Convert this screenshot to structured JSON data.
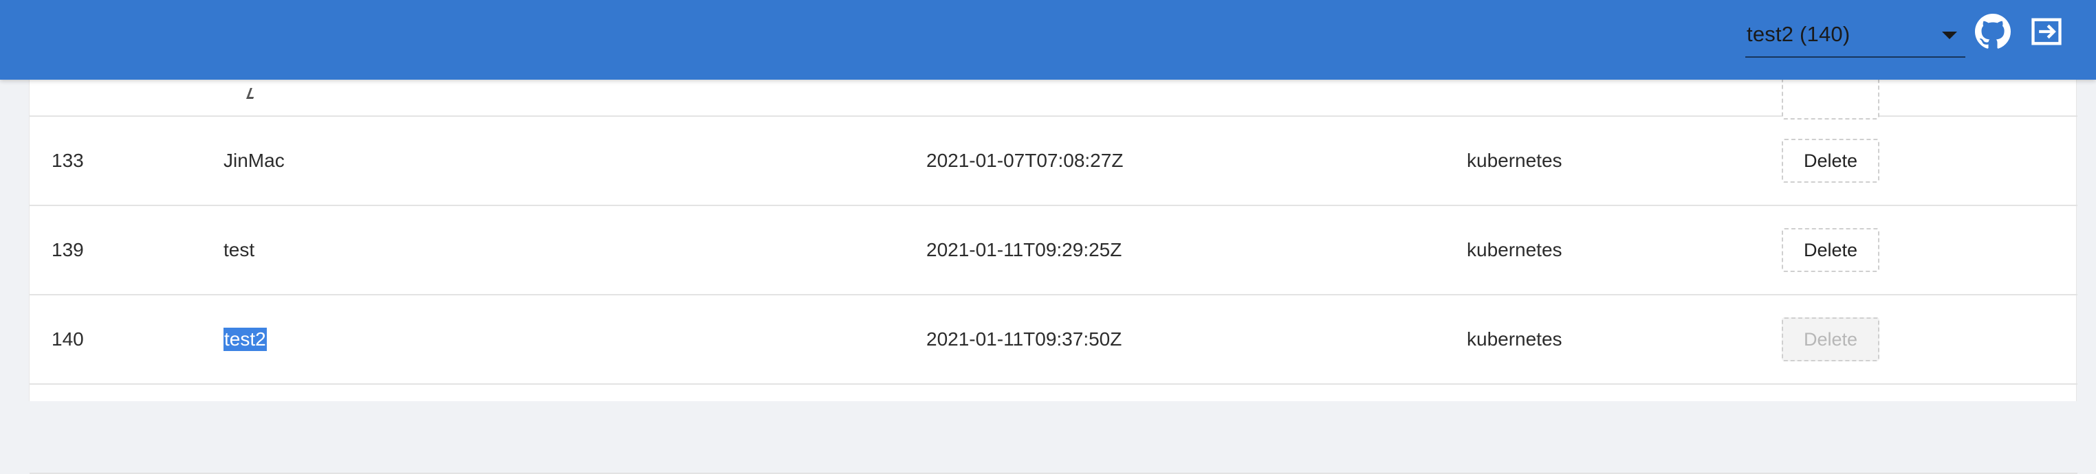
{
  "header": {
    "project_select_value": "test2 (140)",
    "icons": [
      "github-icon",
      "exit-icon"
    ],
    "accent_color": "#3578cf"
  },
  "table": {
    "delete_label": "Delete",
    "rows": [
      {
        "id": "133",
        "name": "JinMac",
        "time": "2021-01-07T07:08:27Z",
        "type": "kubernetes",
        "delete_disabled": false
      },
      {
        "id": "139",
        "name": "test",
        "time": "2021-01-11T09:29:25Z",
        "type": "kubernetes",
        "delete_disabled": false
      },
      {
        "id": "140",
        "name": "test2",
        "time": "2021-01-11T09:37:50Z",
        "type": "kubernetes",
        "delete_disabled": true,
        "name_selected": true
      }
    ]
  }
}
